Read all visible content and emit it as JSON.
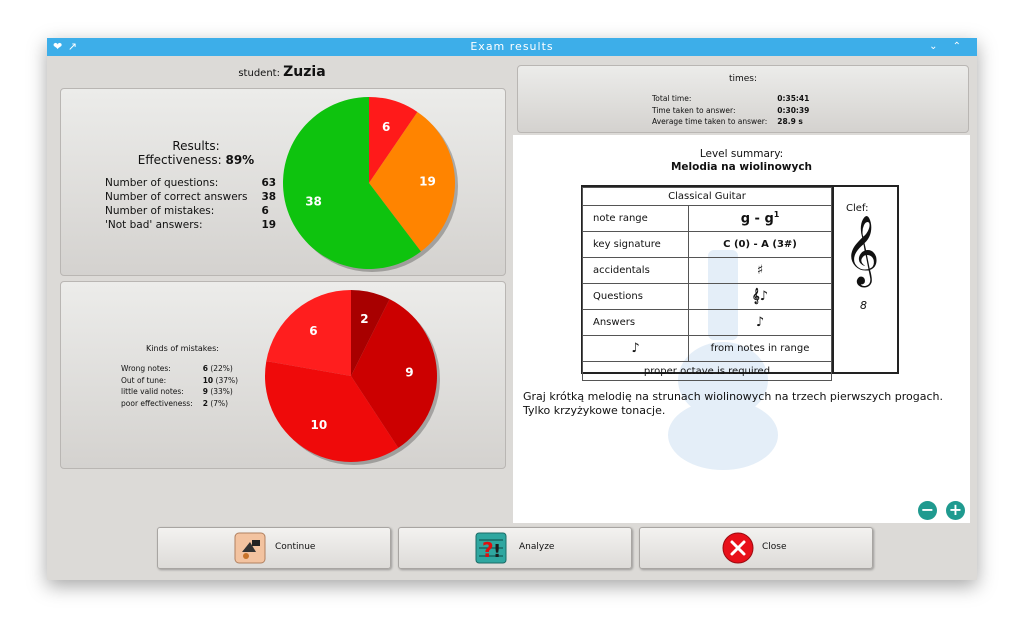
{
  "window": {
    "title": "Exam results"
  },
  "student": {
    "label": "student:",
    "name": "Zuzia"
  },
  "results": {
    "heading": "Results:",
    "effectiveness_label": "Effectiveness:",
    "effectiveness_value": "89%",
    "rows": [
      {
        "label": "Number of questions:",
        "value": "63"
      },
      {
        "label": "Number of correct answers",
        "value": "38"
      },
      {
        "label": "Number of mistakes:",
        "value": "6"
      },
      {
        "label": "'Not bad' answers:",
        "value": "19"
      }
    ]
  },
  "mistakes": {
    "heading": "Kinds of mistakes:",
    "rows": [
      {
        "label": "Wrong notes:",
        "value": "6",
        "pct": "(22%)"
      },
      {
        "label": "Out of tune:",
        "value": "10",
        "pct": "(37%)"
      },
      {
        "label": "little valid notes:",
        "value": "9",
        "pct": "(33%)"
      },
      {
        "label": "poor effectiveness:",
        "value": "2",
        "pct": "(7%)"
      }
    ]
  },
  "times": {
    "heading": "times:",
    "rows": [
      {
        "label": "Total time:",
        "value": "0:35:41"
      },
      {
        "label": "Time taken to answer:",
        "value": "0:30:39"
      },
      {
        "label": "Average time taken to answer:",
        "value": "28.9 s"
      }
    ]
  },
  "level": {
    "heading": "Level summary:",
    "name": "Melodia na wiolinowych",
    "instrument": "Classical Guitar",
    "note_range_label": "note range",
    "note_range_value": "g - g",
    "note_range_sup": "1",
    "key_signature_label": "key signature",
    "key_signature_value": "C (0) - A (3#)",
    "accidentals_label": "accidentals",
    "questions_label": "Questions",
    "answers_label": "Answers",
    "answers_note": "from notes in range",
    "octave_note": "proper octave is required",
    "clef_label": "Clef:",
    "clef_octave": "8",
    "description": "Graj krótką melodię na strunach wiolinowych na trzech pierwszych progach. Tylko krzyżykowe tonacje."
  },
  "buttons": {
    "continue": "Continue",
    "analyze": "Analyze",
    "close": "Close"
  },
  "zoom": {
    "out": "−",
    "in": "+"
  },
  "pie_results": [
    {
      "label": "6",
      "value": 6,
      "color": "#ff1a1a"
    },
    {
      "label": "19",
      "value": 19,
      "color": "#ff8400"
    },
    {
      "label": "38",
      "value": 38,
      "color": "#0ec30e"
    }
  ],
  "pie_mistakes": [
    {
      "label": "2",
      "value": 2,
      "color": "#a80000"
    },
    {
      "label": "9",
      "value": 9,
      "color": "#cc0000"
    },
    {
      "label": "10",
      "value": 10,
      "color": "#ef0a0a"
    },
    {
      "label": "6",
      "value": 6,
      "color": "#ff1e1e"
    }
  ]
}
